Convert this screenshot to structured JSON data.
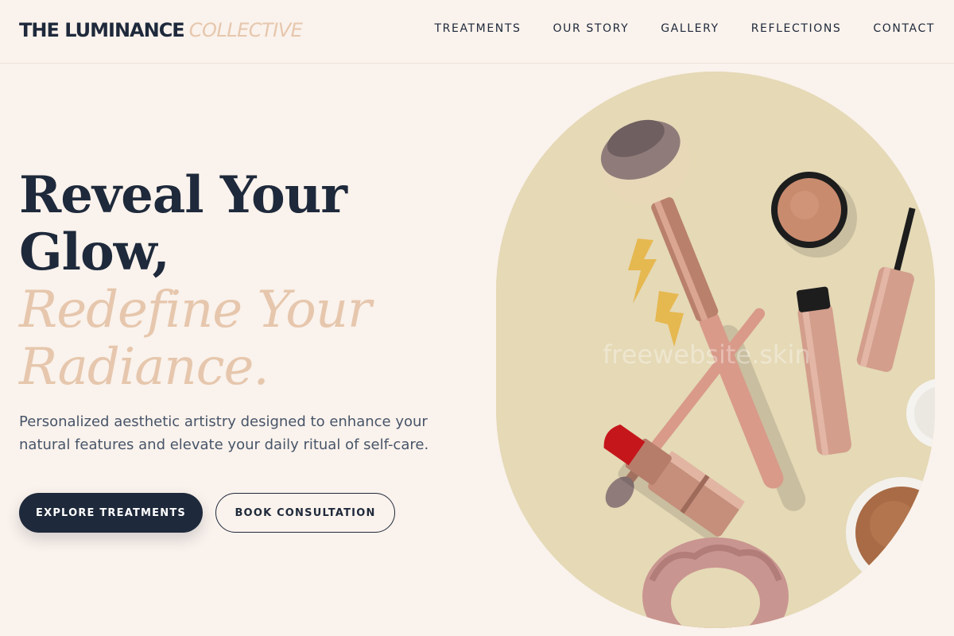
{
  "brand": {
    "main": "THE LUMINANCE",
    "sub": "COLLECTIVE"
  },
  "nav": {
    "items": [
      {
        "label": "TREATMENTS"
      },
      {
        "label": "OUR STORY"
      },
      {
        "label": "GALLERY"
      },
      {
        "label": "REFLECTIONS"
      },
      {
        "label": "CONTACT"
      }
    ]
  },
  "hero": {
    "headline_line1": "Reveal Your",
    "headline_line2": "Glow,",
    "accent_line1": "Redefine Your",
    "accent_line2": "Radiance.",
    "subtext": "Personalized aesthetic artistry designed to enhance your natural features and elevate your daily ritual of self-care.",
    "primary_button": "EXPLORE TREATMENTS",
    "secondary_button": "BOOK CONSULTATION"
  },
  "image": {
    "watermark": "freewebsite.skin"
  },
  "colors": {
    "background": "#faf2ec",
    "navy": "#1e293b",
    "accent": "#e6c7ad",
    "image_bg": "#e5d9b6"
  }
}
